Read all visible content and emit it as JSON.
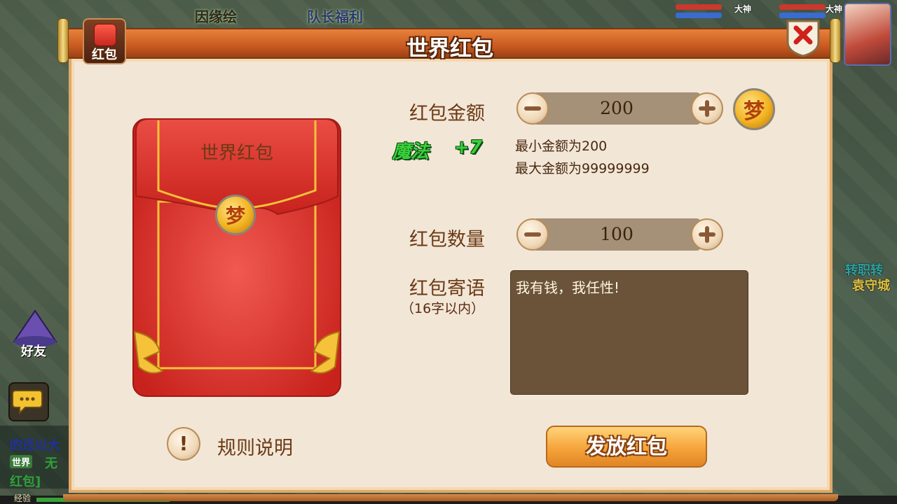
{
  "background": {
    "top_labels": [
      "因缘绘",
      "队长福利"
    ],
    "portrait_tags": [
      "大神",
      "大神"
    ],
    "right_side_text": [
      "转职转",
      "袁守城"
    ],
    "friend_label": "好友",
    "chat_lines": [
      "的还以大",
      "世界",
      "无",
      "红包]"
    ],
    "exp_label": "经验",
    "colors": {
      "hp": "#c9392e",
      "mp": "#3a6bd0",
      "exp": "#3aa23a"
    }
  },
  "dialog": {
    "title": "世界红包",
    "tab_label": "红包",
    "close_icon": "close-x-icon",
    "envelope": {
      "title": "世界红包",
      "coin_glyph": "梦"
    },
    "amount": {
      "label": "红包金额",
      "value": "200",
      "coin_glyph": "梦",
      "min_note": "最小金额为200",
      "max_note": "最大金额为99999999",
      "magic_label": "魔法",
      "magic_value": "+7"
    },
    "count": {
      "label": "红包数量",
      "value": "100"
    },
    "message": {
      "label": "红包寄语",
      "sub_label": "（16字以内）",
      "value": "我有钱，我任性!"
    },
    "rules_label": "规则说明",
    "rules_icon": "exclamation-icon",
    "send_label": "发放红包",
    "colors": {
      "title_bar": "#d86a2a",
      "panel": "#f2e6d7",
      "envelope": "#d8322c",
      "text_brown": "#6b3a14",
      "magic_green": "#39d03a",
      "send_button": "#f5a43a"
    }
  }
}
